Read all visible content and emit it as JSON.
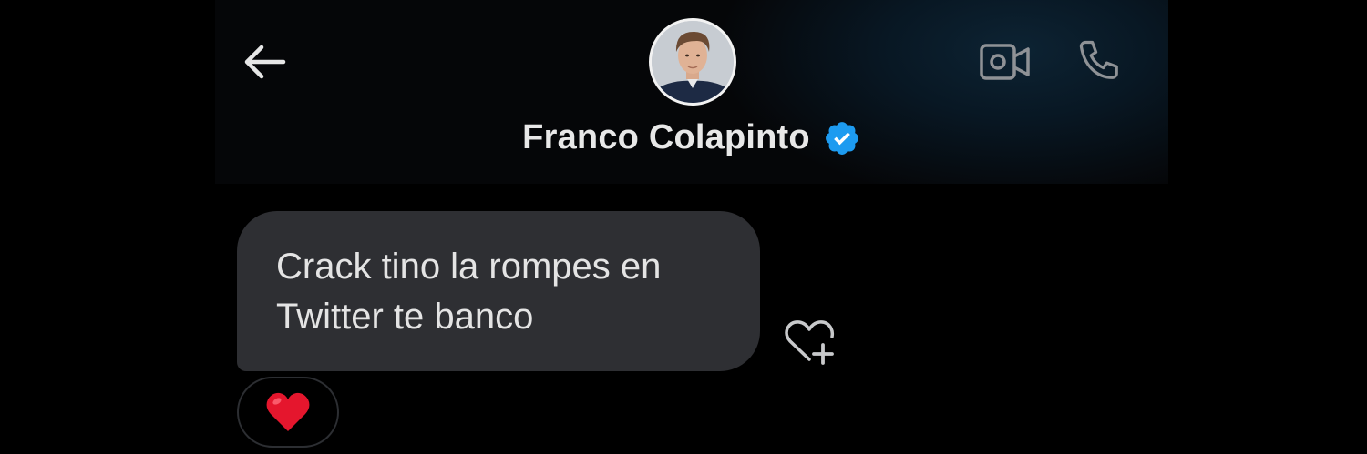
{
  "header": {
    "contact_name": "Franco Colapinto",
    "verified": true,
    "icons": {
      "back": "arrow-left-icon",
      "video": "video-camera-icon",
      "phone": "phone-icon",
      "verified": "verified-badge-icon"
    }
  },
  "colors": {
    "background": "#000000",
    "bubble": "#2e2f33",
    "verified_blue": "#1d9bf0",
    "heart_red": "#e0245e"
  },
  "messages": [
    {
      "text_lines": [
        "Crack tino la rompes en",
        "Twitter te banco"
      ],
      "reaction": "heart-emoji"
    }
  ],
  "actions": {
    "add_reaction_icon": "heart-plus-icon"
  }
}
